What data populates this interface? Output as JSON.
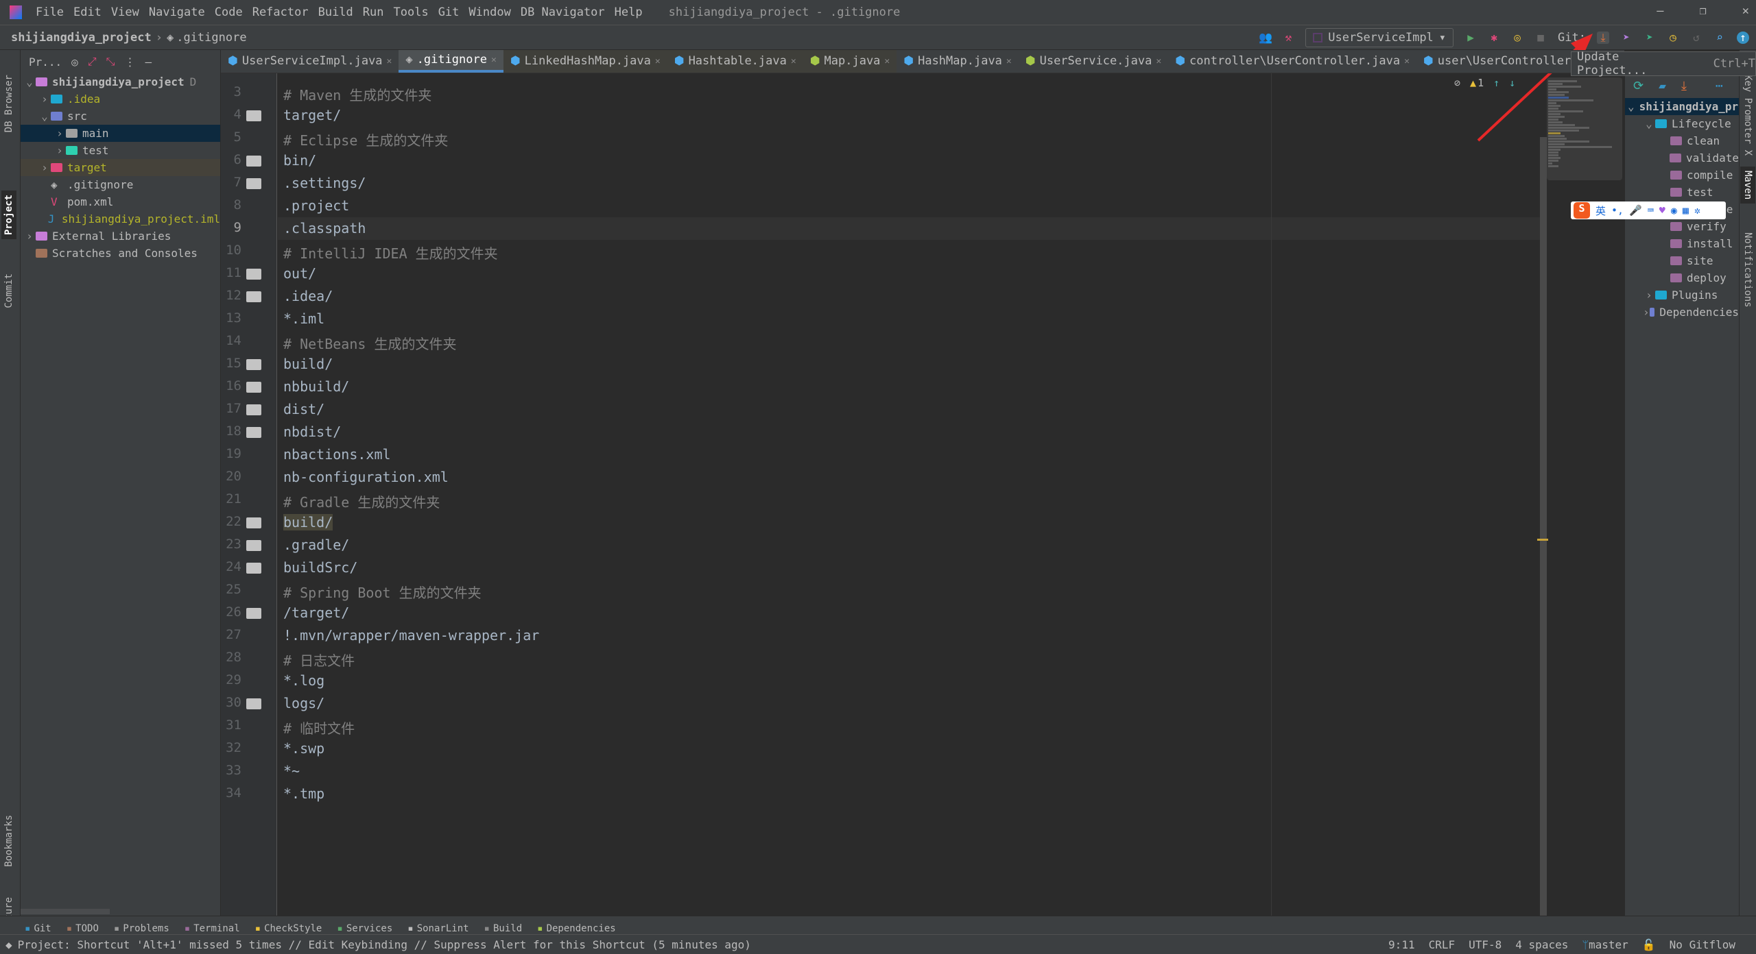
{
  "menu": [
    "File",
    "Edit",
    "View",
    "Navigate",
    "Code",
    "Refactor",
    "Build",
    "Run",
    "Tools",
    "Git",
    "Window",
    "DB Navigator",
    "Help"
  ],
  "window_title": "shijiangdiya_project - .gitignore",
  "breadcrumb": {
    "project": "shijiangdiya_project",
    "file": ".gitignore"
  },
  "toolbar": {
    "run_config": "UserServiceImpl",
    "git_label": "Git:"
  },
  "tooltip": {
    "label": "Update Project...",
    "shortcut": "Ctrl+T"
  },
  "left_strip": [
    "DB Browser",
    "Project",
    "Commit",
    "Bookmarks",
    "Structure"
  ],
  "project_panel": {
    "title": "Pr...",
    "items": [
      {
        "label": "shijiangdiya_project",
        "extra": "D",
        "depth": 0,
        "arrow": "v"
      },
      {
        "label": ".idea",
        "depth": 1,
        "arrow": ">"
      },
      {
        "label": "src",
        "depth": 1,
        "arrow": "v"
      },
      {
        "label": "main",
        "depth": 2,
        "arrow": ">"
      },
      {
        "label": "test",
        "depth": 2,
        "arrow": ">"
      },
      {
        "label": "target",
        "depth": 1,
        "arrow": ">"
      },
      {
        "label": ".gitignore",
        "depth": 1,
        "arrow": ""
      },
      {
        "label": "pom.xml",
        "depth": 1,
        "arrow": ""
      },
      {
        "label": "shijiangdiya_project.iml",
        "depth": 1,
        "arrow": ""
      },
      {
        "label": "External Libraries",
        "depth": 0,
        "arrow": ">"
      },
      {
        "label": "Scratches and Consoles",
        "depth": 0,
        "arrow": ""
      }
    ]
  },
  "tabs": [
    "UserServiceImpl.java",
    ".gitignore",
    "LinkedHashMap.java",
    "Hashtable.java",
    "Map.java",
    "HashMap.java",
    "UserService.java",
    "controller\\UserController.java",
    "user\\UserController"
  ],
  "active_tab": ".gitignore",
  "editor": {
    "inspection_count": "1",
    "lines": [
      {
        "n": "3",
        "text": "# Maven 生成的文件夹",
        "comment": true
      },
      {
        "n": "4",
        "text": "target/",
        "folder": true
      },
      {
        "n": "5",
        "text": "# Eclipse 生成的文件夹",
        "comment": true
      },
      {
        "n": "6",
        "text": "bin/",
        "folder": true
      },
      {
        "n": "7",
        "text": ".settings/",
        "folder": true
      },
      {
        "n": "8",
        "text": ".project"
      },
      {
        "n": "9",
        "text": ".classpath",
        "current": true
      },
      {
        "n": "10",
        "text": "# IntelliJ IDEA 生成的文件夹",
        "comment": true
      },
      {
        "n": "11",
        "text": "out/",
        "folder": true
      },
      {
        "n": "12",
        "text": ".idea/",
        "folder": true
      },
      {
        "n": "13",
        "text": "*.iml"
      },
      {
        "n": "14",
        "text": "# NetBeans 生成的文件夹",
        "comment": true
      },
      {
        "n": "15",
        "text": "build/",
        "folder": true
      },
      {
        "n": "16",
        "text": "nbbuild/",
        "folder": true
      },
      {
        "n": "17",
        "text": "dist/",
        "folder": true
      },
      {
        "n": "18",
        "text": "nbdist/",
        "folder": true
      },
      {
        "n": "19",
        "text": "nbactions.xml"
      },
      {
        "n": "20",
        "text": "nb-configuration.xml"
      },
      {
        "n": "21",
        "text": "# Gradle 生成的文件夹",
        "comment": true
      },
      {
        "n": "22",
        "text": "build/",
        "folder": true,
        "highlight": true
      },
      {
        "n": "23",
        "text": ".gradle/",
        "folder": true
      },
      {
        "n": "24",
        "text": "buildSrc/",
        "folder": true
      },
      {
        "n": "25",
        "text": "# Spring Boot 生成的文件夹",
        "comment": true
      },
      {
        "n": "26",
        "text": "/target/",
        "folder": true
      },
      {
        "n": "27",
        "text": "!.mvn/wrapper/maven-wrapper.jar"
      },
      {
        "n": "28",
        "text": "# 日志文件",
        "comment": true
      },
      {
        "n": "29",
        "text": "*.log"
      },
      {
        "n": "30",
        "text": "logs/",
        "folder": true
      },
      {
        "n": "31",
        "text": "# 临时文件",
        "comment": true
      },
      {
        "n": "32",
        "text": "*.swp"
      },
      {
        "n": "33",
        "text": "*~"
      },
      {
        "n": "34",
        "text": "*.tmp"
      }
    ]
  },
  "maven": {
    "items": [
      {
        "label": "shijiangdiya_project",
        "depth": 0,
        "arrow": "v"
      },
      {
        "label": "Lifecycle",
        "depth": 1,
        "arrow": "v"
      },
      {
        "label": "clean",
        "depth": 2
      },
      {
        "label": "validate",
        "depth": 2
      },
      {
        "label": "compile",
        "depth": 2
      },
      {
        "label": "test",
        "depth": 2
      },
      {
        "label": "package",
        "depth": 2
      },
      {
        "label": "verify",
        "depth": 2
      },
      {
        "label": "install",
        "depth": 2
      },
      {
        "label": "site",
        "depth": 2
      },
      {
        "label": "deploy",
        "depth": 2
      },
      {
        "label": "Plugins",
        "depth": 1,
        "arrow": ">"
      },
      {
        "label": "Dependencies",
        "depth": 1,
        "arrow": ">"
      }
    ]
  },
  "right_strip": [
    "Key Promoter X",
    "Maven",
    "Notifications"
  ],
  "ime": {
    "mode": "英",
    "punct": "•,"
  },
  "bottom_tools": [
    "Git",
    "TODO",
    "Problems",
    "Terminal",
    "CheckStyle",
    "Services",
    "SonarLint",
    "Build",
    "Dependencies"
  ],
  "status": {
    "message": "Project: Shortcut 'Alt+1' missed 5 times // Edit Keybinding // Suppress Alert for this Shortcut (5 minutes ago)",
    "position": "9:11",
    "line_sep": "CRLF",
    "encoding": "UTF-8",
    "indent": "4 spaces",
    "branch": "master",
    "gitflow": "No Gitflow"
  }
}
